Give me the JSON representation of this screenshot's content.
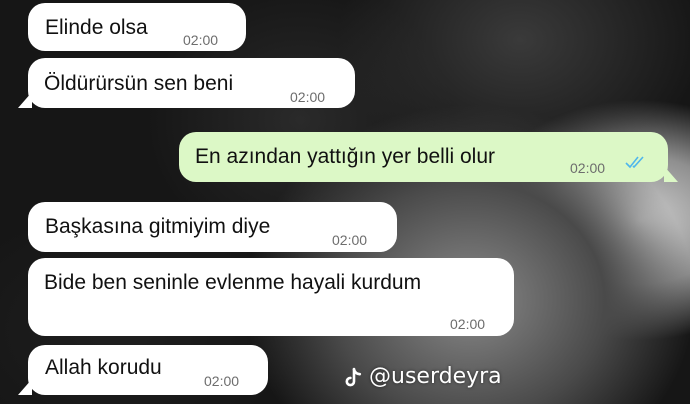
{
  "messages": [
    {
      "text": "Elinde olsa",
      "time": "02:00",
      "direction": "in"
    },
    {
      "text": "Öldürürsün sen beni",
      "time": "02:00",
      "direction": "in"
    },
    {
      "text": "En azından yattığın yer belli olur",
      "time": "02:00",
      "direction": "out",
      "status": "read-double-check"
    },
    {
      "text": "Başkasına gitmiyim diye",
      "time": "02:00",
      "direction": "in"
    },
    {
      "text": "Bide ben seninle evlenme hayali kurdum",
      "time": "02:00",
      "direction": "in"
    },
    {
      "text": "Allah korudu",
      "time": "02:00",
      "direction": "in"
    }
  ],
  "watermark": {
    "handle": "@userdeyra",
    "icon": "tiktok-icon"
  },
  "colors": {
    "incoming": "#ffffff",
    "outgoing": "#dcf8c6",
    "read_ticks": "#4fb6ec"
  }
}
